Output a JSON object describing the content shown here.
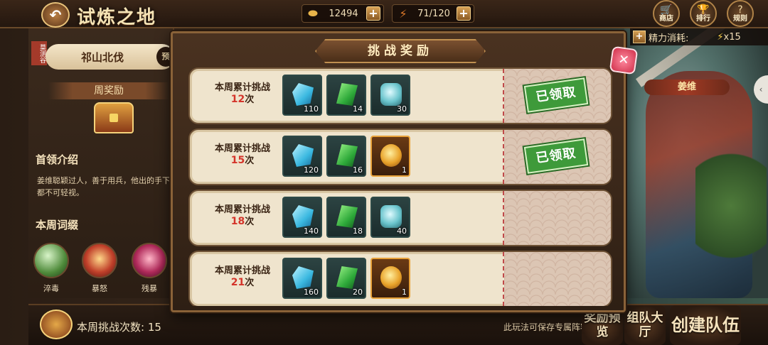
{
  "header": {
    "title": "试炼之地",
    "gold": "12494",
    "energy": "71/120",
    "icons": [
      {
        "name": "shop",
        "label": "商店",
        "glyph": "🛒"
      },
      {
        "name": "rank",
        "label": "排行",
        "glyph": "🏆"
      },
      {
        "name": "rules",
        "label": "规则",
        "glyph": "?"
      }
    ]
  },
  "left": {
    "boss_tag": "莫测谷",
    "boss_name": "祁山北伐",
    "boss_ext": "预",
    "week_reward": "周奖励",
    "intro_heading": "首领介绍",
    "intro_text": "姜维聪颖过人，善于用兵，他出的手下都不可轻视。",
    "affix_heading": "本周词缀",
    "affixes": [
      "淬毒",
      "暴怒",
      "残暴"
    ]
  },
  "right": {
    "energy_cost_label": "精力消耗:",
    "energy_cost_value": "x15",
    "hero_name": "姜维"
  },
  "modal": {
    "title": "挑战奖励",
    "row_prefix": "本周累计挑战",
    "row_suffix": "次",
    "claimed_label": "已领取",
    "rows": [
      {
        "count": "12",
        "claimed": true,
        "rewards": [
          {
            "type": "crystal",
            "qty": "110"
          },
          {
            "type": "emerald",
            "qty": "14"
          },
          {
            "type": "jade",
            "qty": "30"
          }
        ]
      },
      {
        "count": "15",
        "claimed": true,
        "rewards": [
          {
            "type": "crystal",
            "qty": "120"
          },
          {
            "type": "emerald",
            "qty": "16"
          },
          {
            "type": "medal",
            "qty": "1"
          }
        ]
      },
      {
        "count": "18",
        "claimed": false,
        "rewards": [
          {
            "type": "crystal",
            "qty": "140"
          },
          {
            "type": "emerald",
            "qty": "18"
          },
          {
            "type": "jade",
            "qty": "40"
          }
        ]
      },
      {
        "count": "21",
        "claimed": false,
        "rewards": [
          {
            "type": "crystal",
            "qty": "160"
          },
          {
            "type": "emerald",
            "qty": "20"
          },
          {
            "type": "medal",
            "qty": "1"
          }
        ]
      }
    ]
  },
  "bottom": {
    "weekly_count_label": "本周挑战次数:",
    "weekly_count_value": "15",
    "note": "此玩法可保存专属阵容",
    "buttons": [
      {
        "name": "reward-preview",
        "label": "奖励预览"
      },
      {
        "name": "team-hall",
        "label": "组队大厅"
      },
      {
        "name": "create-team",
        "label": "创建队伍"
      }
    ]
  }
}
